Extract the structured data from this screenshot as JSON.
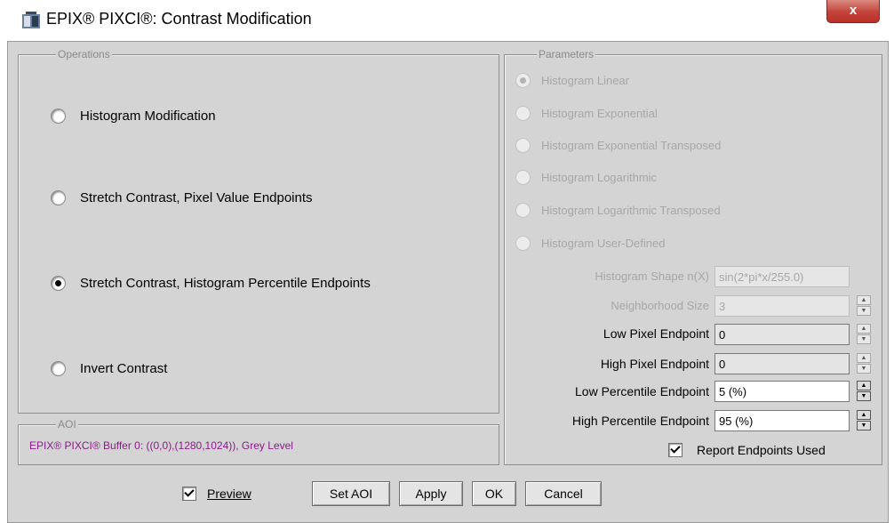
{
  "window": {
    "title": "EPIX® PIXCI®: Contrast Modification",
    "close_label": "x",
    "icon": "app-icon"
  },
  "operations": {
    "legend": "Operations",
    "options": [
      {
        "label": "Histogram Modification",
        "selected": false
      },
      {
        "label": "Stretch Contrast, Pixel Value Endpoints",
        "selected": false
      },
      {
        "label": "Stretch Contrast, Histogram Percentile Endpoints",
        "selected": true
      },
      {
        "label": "Invert Contrast",
        "selected": false
      }
    ]
  },
  "aoi": {
    "legend": "AOI",
    "text": "EPIX® PIXCI® Buffer 0: ((0,0),(1280,1024)), Grey Level"
  },
  "parameters": {
    "legend": "Parameters",
    "options": [
      {
        "label": "Histogram Linear",
        "selected": true,
        "enabled": false
      },
      {
        "label": "Histogram Exponential",
        "selected": false,
        "enabled": false
      },
      {
        "label": "Histogram Exponential Transposed",
        "selected": false,
        "enabled": false
      },
      {
        "label": "Histogram Logarithmic",
        "selected": false,
        "enabled": false
      },
      {
        "label": "Histogram Logarithmic Transposed",
        "selected": false,
        "enabled": false
      },
      {
        "label": "Histogram User-Defined",
        "selected": false,
        "enabled": false
      }
    ],
    "fields": {
      "shape": {
        "label": "Histogram Shape n(X)",
        "value": "sin(2*pi*x/255.0)",
        "enabled": false
      },
      "neighborhood": {
        "label": "Neighborhood Size",
        "value": "3",
        "enabled": false
      },
      "low_pixel": {
        "label": "Low Pixel Endpoint",
        "value": "0",
        "enabled": false
      },
      "high_pixel": {
        "label": "High Pixel Endpoint",
        "value": "0",
        "enabled": false
      },
      "low_percentile": {
        "label": "Low Percentile Endpoint",
        "value": "5 (%)",
        "enabled": true
      },
      "high_percentile": {
        "label": "High Percentile Endpoint",
        "value": "95 (%)",
        "enabled": true
      }
    },
    "report_endpoints": {
      "label": "Report Endpoints Used",
      "checked": true
    }
  },
  "footer": {
    "preview": {
      "label": "Preview",
      "checked": true
    },
    "buttons": {
      "set_aoi": "Set AOI",
      "apply": "Apply",
      "ok": "OK",
      "cancel": "Cancel"
    }
  },
  "colors": {
    "dialog_bg": "#d4d4d4",
    "close_button": "#c4433a",
    "aoi_text": "#8b1a8b",
    "disabled_text": "#a7a7a7"
  }
}
